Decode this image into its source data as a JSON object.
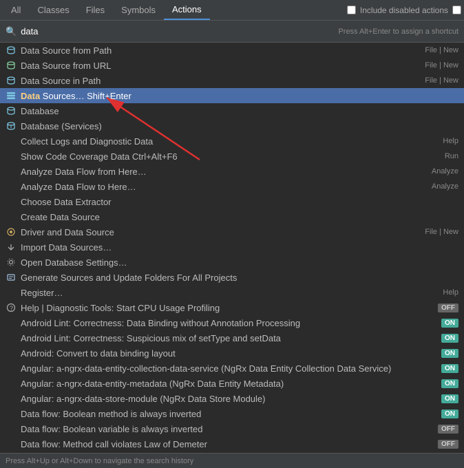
{
  "tabs": [
    {
      "label": "All",
      "active": false
    },
    {
      "label": "Classes",
      "active": false
    },
    {
      "label": "Files",
      "active": false
    },
    {
      "label": "Symbols",
      "active": false
    },
    {
      "label": "Actions",
      "active": true
    }
  ],
  "include_disabled": {
    "label": "Include disabled actions"
  },
  "search": {
    "value": "data",
    "placeholder": "data",
    "hint": "Press Alt+Enter to assign a shortcut"
  },
  "status_bar": {
    "text": "Press Alt+Up or Alt+Down to navigate the search history"
  },
  "results": [
    {
      "icon": "db-path",
      "label": "Data Source from Path",
      "meta": "File | New",
      "selected": false,
      "separator_after": false
    },
    {
      "icon": "db-url",
      "label": "Data Source from URL",
      "meta": "File | New",
      "selected": false,
      "separator_after": false
    },
    {
      "icon": "db-path",
      "label": "Data Source in Path",
      "meta": "File | New",
      "selected": false,
      "separator_after": false
    },
    {
      "icon": "data-sources",
      "label": "Data Sources…  Shift+Enter",
      "meta": "",
      "selected": true,
      "highlight": "Data",
      "separator_after": false
    },
    {
      "icon": "db",
      "label": "Database",
      "meta": "",
      "selected": false,
      "separator_after": false
    },
    {
      "icon": "db-services",
      "label": "Database (Services)",
      "meta": "",
      "selected": false,
      "separator_after": false
    },
    {
      "icon": "none",
      "label": "Collect Logs and Diagnostic Data",
      "meta": "Help",
      "selected": false,
      "separator_after": false
    },
    {
      "icon": "none",
      "label": "Show Code Coverage Data  Ctrl+Alt+F6",
      "meta": "Run",
      "selected": false,
      "separator_after": false
    },
    {
      "icon": "none",
      "label": "Analyze Data Flow from Here…",
      "meta": "Analyze",
      "selected": false,
      "separator_after": false
    },
    {
      "icon": "none",
      "label": "Analyze Data Flow to Here…",
      "meta": "Analyze",
      "selected": false,
      "separator_after": false
    },
    {
      "icon": "none",
      "label": "Choose Data Extractor",
      "meta": "",
      "selected": false,
      "separator_after": false
    },
    {
      "icon": "none",
      "label": "Create Data Source",
      "meta": "",
      "selected": false,
      "separator_after": false
    },
    {
      "icon": "driver",
      "label": "Driver and Data Source",
      "meta": "File | New",
      "selected": false,
      "separator_after": false
    },
    {
      "icon": "import",
      "label": "Import Data Sources…",
      "meta": "",
      "selected": false,
      "separator_after": false
    },
    {
      "icon": "settings",
      "label": "Open Database Settings…",
      "meta": "",
      "selected": false,
      "separator_after": false
    },
    {
      "icon": "generate",
      "label": "Generate Sources and Update Folders For All Projects",
      "meta": "",
      "selected": false,
      "separator_after": false
    },
    {
      "icon": "none",
      "label": "Register…",
      "meta": "Help",
      "selected": false,
      "separator_after": false
    },
    {
      "icon": "help",
      "label": "Help | Diagnostic Tools: Start CPU Usage Profiling",
      "meta": "OFF",
      "badge": "off",
      "selected": false,
      "separator_after": false
    },
    {
      "icon": "none",
      "label": "Android Lint: Correctness: Data Binding without Annotation Processing",
      "meta": "ON",
      "badge": "on",
      "selected": false,
      "separator_after": false
    },
    {
      "icon": "none",
      "label": "Android Lint: Correctness: Suspicious mix of setType and setData",
      "meta": "ON",
      "badge": "on",
      "selected": false,
      "separator_after": false
    },
    {
      "icon": "none",
      "label": "Android: Convert to data binding layout",
      "meta": "ON",
      "badge": "on",
      "selected": false,
      "separator_after": false
    },
    {
      "icon": "none",
      "label": "Angular: a-ngrx-data-entity-collection-data-service (NgRx Data Entity Collection Data Service)",
      "meta": "ON",
      "badge": "on",
      "selected": false,
      "separator_after": false
    },
    {
      "icon": "none",
      "label": "Angular: a-ngrx-data-entity-metadata (NgRx Data Entity Metadata)",
      "meta": "ON",
      "badge": "on",
      "selected": false,
      "separator_after": false
    },
    {
      "icon": "none",
      "label": "Angular: a-ngrx-data-store-module (NgRx Data Store Module)",
      "meta": "ON",
      "badge": "on",
      "selected": false,
      "separator_after": false
    },
    {
      "icon": "none",
      "label": "Data flow: Boolean method is always inverted",
      "meta": "ON",
      "badge": "on",
      "selected": false,
      "separator_after": false
    },
    {
      "icon": "none",
      "label": "Data flow: Boolean variable is always inverted",
      "meta": "OFF",
      "badge": "off",
      "selected": false,
      "separator_after": false
    },
    {
      "icon": "none",
      "label": "Data flow: Method call violates Law of Demeter",
      "meta": "OFF",
      "badge": "off",
      "selected": false,
      "separator_after": false
    }
  ]
}
